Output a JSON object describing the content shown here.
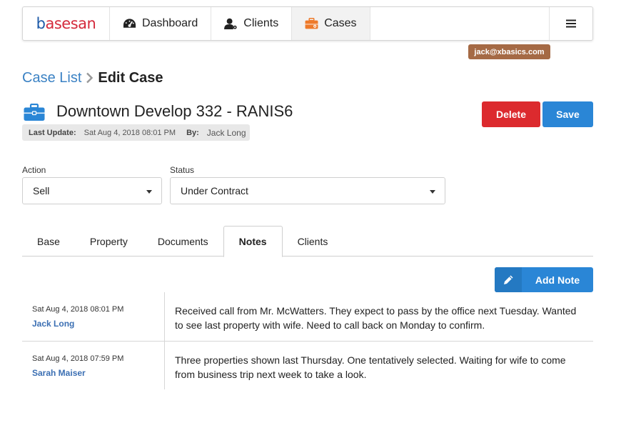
{
  "nav": {
    "logo_b": "b",
    "logo_rest": "asesan",
    "items": [
      {
        "label": "Dashboard",
        "icon": "dashboard-gauge-icon"
      },
      {
        "label": "Clients",
        "icon": "user-gear-icon"
      },
      {
        "label": "Cases",
        "icon": "briefcase-icon"
      }
    ],
    "active": "Cases",
    "menu_icon": "hamburger-menu-icon"
  },
  "user": {
    "email": "jack@xbasics.com"
  },
  "breadcrumb": {
    "parent": "Case List",
    "current": "Edit Case"
  },
  "case": {
    "icon": "briefcase-icon",
    "title": "Downtown Develop 332 - RANIS6",
    "last_update_label": "Last Update:",
    "last_update_value": "Sat Aug 4, 2018 08:01 PM",
    "by_label": "By:",
    "by_value": "Jack Long"
  },
  "actions": {
    "delete_label": "Delete",
    "save_label": "Save"
  },
  "fields": {
    "action": {
      "label": "Action",
      "value": "Sell"
    },
    "status": {
      "label": "Status",
      "value": "Under Contract"
    }
  },
  "tabs": [
    "Base",
    "Property",
    "Documents",
    "Notes",
    "Clients"
  ],
  "active_tab": "Notes",
  "add_note": {
    "label": "Add Note",
    "icon": "pencil-icon"
  },
  "notes": [
    {
      "date": "Sat Aug 4, 2018 08:01 PM",
      "author": "Jack Long",
      "text": "Received call from Mr. McWatters. They expect to pass by the office next Tuesday. Wanted to see last property with wife. Need to call back on Monday to confirm."
    },
    {
      "date": "Sat Aug 4, 2018 07:59 PM",
      "author": "Sarah Maiser",
      "text": "Three properties shown last Thursday. One tentatively selected. Waiting for wife to come from business trip next week to take a look."
    }
  ],
  "colors": {
    "accent": "#2a86d6",
    "danger": "#dc2a2e",
    "badge": "#a56a45",
    "active_nav_icon": "#ee7a2a",
    "link": "#3b82c4"
  }
}
